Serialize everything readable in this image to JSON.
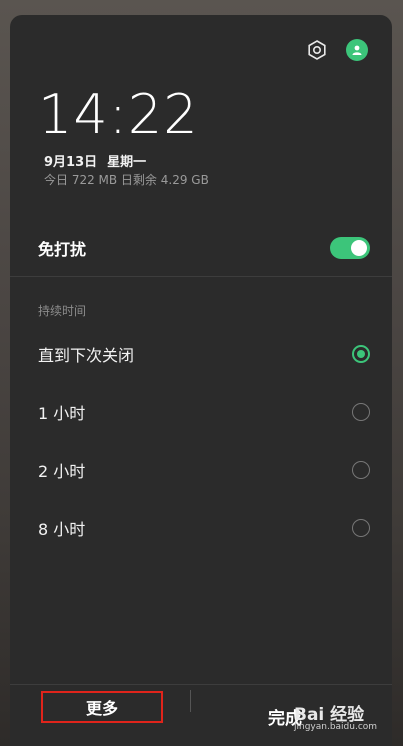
{
  "header": {
    "time": "14:22",
    "date": "9月13日",
    "weekday": "星期一",
    "storage": "今日 722 MB 日剩余 4.29 GB"
  },
  "dnd": {
    "label": "免打扰",
    "enabled": true
  },
  "duration": {
    "section_label": "持续时间",
    "options": [
      {
        "label": "直到下次关闭",
        "selected": true
      },
      {
        "label": "1 小时",
        "selected": false
      },
      {
        "label": "2 小时",
        "selected": false
      },
      {
        "label": "8 小时",
        "selected": false
      }
    ]
  },
  "footer": {
    "more_label": "更多",
    "done_label": "完成"
  },
  "watermark": {
    "text": "Bai 经验",
    "sub": "jingyan.baidu.com"
  },
  "colors": {
    "accent": "#3cc57a",
    "highlight_box": "#e0241b"
  }
}
